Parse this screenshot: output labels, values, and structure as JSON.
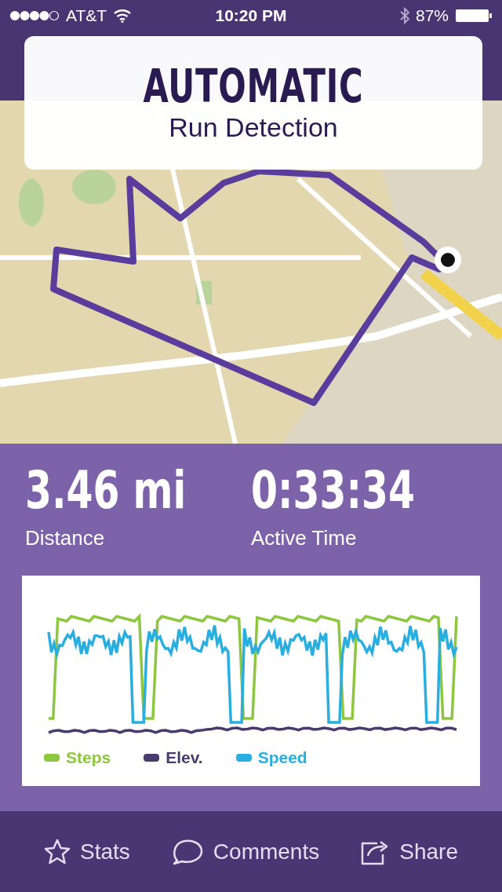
{
  "status_bar": {
    "carrier": "AT&T",
    "time": "10:20 PM",
    "battery": "87%"
  },
  "callout": {
    "title": "AUTOMATIC",
    "subtitle": "Run Detection"
  },
  "stats": [
    {
      "value": "3.46 mi",
      "label": "Distance"
    },
    {
      "value": "0:33:34",
      "label": "Active Time"
    }
  ],
  "chart": {
    "legend": [
      {
        "label": "Steps",
        "color": "#8dc63f"
      },
      {
        "label": "Elev.",
        "color": "#4a3b6e"
      },
      {
        "label": "Speed",
        "color": "#29aee0"
      }
    ]
  },
  "tab_bar": [
    {
      "kind": "star",
      "label": "Stats"
    },
    {
      "kind": "comment",
      "label": "Comments"
    },
    {
      "kind": "share",
      "label": "Share"
    }
  ]
}
